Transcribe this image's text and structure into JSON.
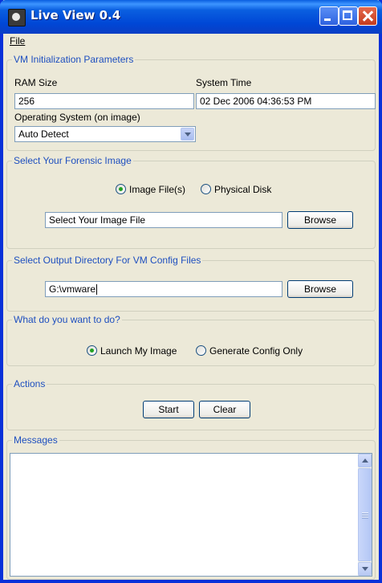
{
  "window": {
    "title": "Live View 0.4"
  },
  "menu": {
    "file": "File"
  },
  "vm_params": {
    "group_label": "VM Initialization Parameters",
    "ram_label": "RAM Size",
    "ram_value": "256",
    "time_label": "System Time",
    "time_value": "02 Dec 2006 04:36:53 PM",
    "os_label": "Operating System (on image)",
    "os_value": "Auto Detect"
  },
  "forensic_image": {
    "group_label": "Select Your Forensic Image",
    "options": [
      "Image File(s)",
      "Physical Disk"
    ],
    "selected": "Image File(s)",
    "path_value": "Select Your Image File",
    "browse_label": "Browse"
  },
  "output_dir": {
    "group_label": "Select Output Directory For VM Config Files",
    "path_value": "G:\\vmware",
    "browse_label": "Browse"
  },
  "action_choice": {
    "group_label": "What do you want to do?",
    "options": [
      "Launch My Image",
      "Generate Config Only"
    ],
    "selected": "Launch My Image"
  },
  "actions": {
    "group_label": "Actions",
    "start_label": "Start",
    "clear_label": "Clear"
  },
  "messages": {
    "group_label": "Messages",
    "content": ""
  }
}
